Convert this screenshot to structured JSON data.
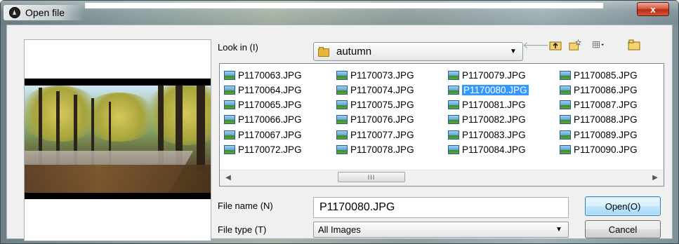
{
  "window": {
    "title": "Open file",
    "close_label": "x"
  },
  "look_in": {
    "label": "Look in (I)",
    "value": "autumn"
  },
  "toolbar": {
    "back_icon": "back-arrow-icon",
    "up_icon": "up-folder-icon",
    "new_folder_icon": "new-folder-icon",
    "view_icon": "view-menu-icon",
    "recent_icon": "recent-folder-icon"
  },
  "files": [
    "P1170063.JPG",
    "P1170064.JPG",
    "P1170065.JPG",
    "P1170066.JPG",
    "P1170067.JPG",
    "P1170072.JPG",
    "P1170073.JPG",
    "P1170074.JPG",
    "P1170075.JPG",
    "P1170076.JPG",
    "P1170077.JPG",
    "P1170078.JPG",
    "P1170079.JPG",
    "P1170080.JPG",
    "P1170081.JPG",
    "P1170082.JPG",
    "P1170083.JPG",
    "P1170084.JPG",
    "P1170085.JPG",
    "P1170086.JPG",
    "P1170087.JPG",
    "P1170088.JPG",
    "P1170089.JPG",
    "P1170090.JPG"
  ],
  "selected_file": "P1170080.JPG",
  "scrollbar": {
    "thumb_grip": "III"
  },
  "file_name": {
    "label": "File name (N)",
    "value": "P1170080.JPG"
  },
  "file_type": {
    "label": "File type (T)",
    "value": "All Images"
  },
  "buttons": {
    "open": "Open(O)",
    "cancel": "Cancel"
  }
}
